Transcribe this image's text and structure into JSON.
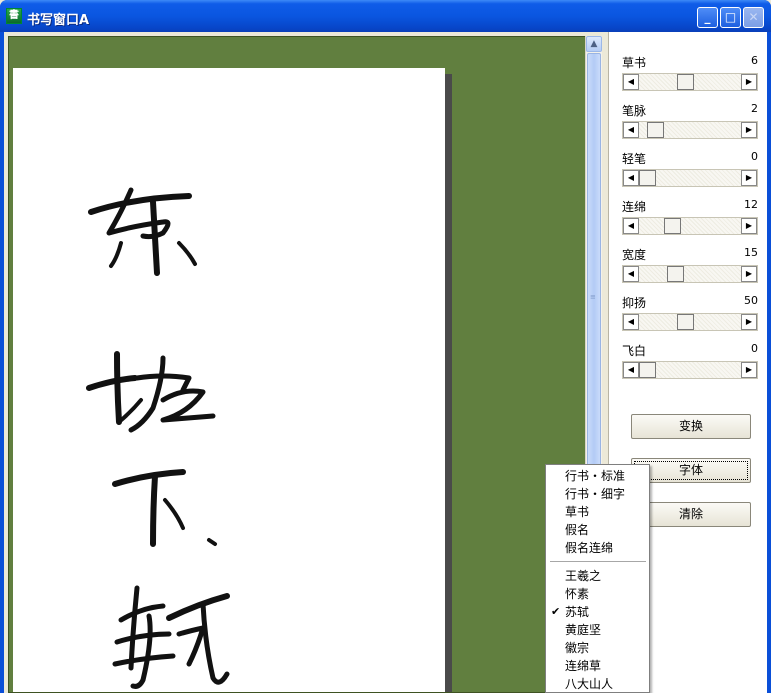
{
  "window": {
    "title": "书写窗口A"
  },
  "panel": {
    "params": [
      {
        "label": "草书",
        "value": "6",
        "knob_fraction": 0.45
      },
      {
        "label": "笔脉",
        "value": "2",
        "knob_fraction": 0.09
      },
      {
        "label": "轻笔",
        "value": "0",
        "knob_fraction": 0.0
      },
      {
        "label": "连绵",
        "value": "12",
        "knob_fraction": 0.29
      },
      {
        "label": "宽度",
        "value": "15",
        "knob_fraction": 0.33
      },
      {
        "label": "抑扬",
        "value": "50",
        "knob_fraction": 0.45
      },
      {
        "label": "飞白",
        "value": "0",
        "knob_fraction": 0.0
      }
    ],
    "buttons": {
      "transform": "变换",
      "font": "字体",
      "clear": "清除"
    }
  },
  "menu": {
    "group1": [
      "行书・标准",
      "行书・细字",
      "草书",
      "假名",
      "假名连绵"
    ],
    "group2": [
      "王羲之",
      "怀素",
      "苏轼",
      "黄庭坚",
      "徽宗",
      "连绵草",
      "八大山人"
    ],
    "checked": "苏轼"
  },
  "canvas": {
    "text": "东坡下轼",
    "background": "#617f3f"
  }
}
